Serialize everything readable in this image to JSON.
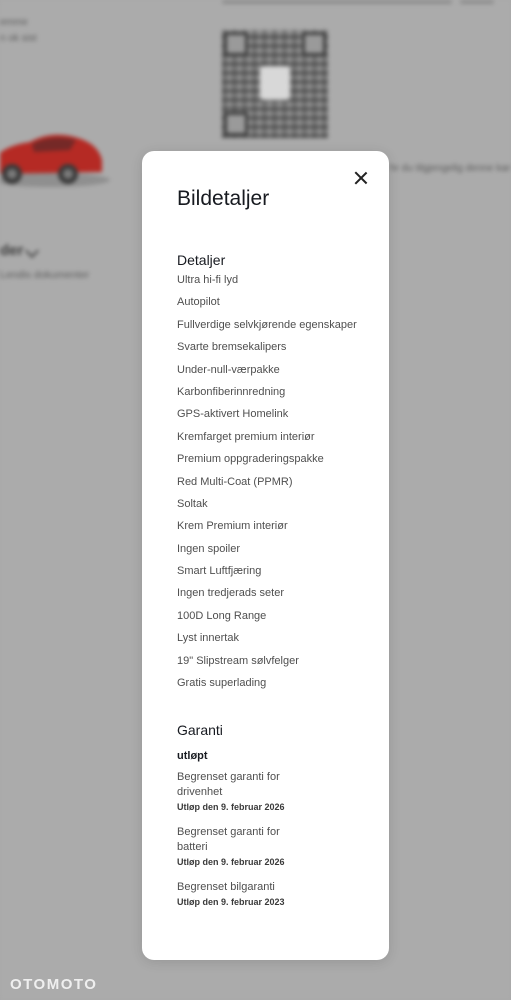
{
  "background": {
    "text_line_1": "emme",
    "text_line_2": "n ok sist",
    "right_note": "hr du tilgjengelig denne kan",
    "heading_fragment": "der",
    "subtext": "Lendis dokumenter",
    "brand": "OTOMOTO"
  },
  "modal": {
    "title": "Bildetaljer",
    "details": {
      "title": "Detaljer",
      "items": [
        "Ultra hi-fi lyd",
        "Autopilot",
        "Fullverdige selvkjørende egenskaper",
        "Svarte bremsekalipers",
        "Under-null-værpakke",
        "Karbonfiberinnredning",
        "GPS-aktivert Homelink",
        "Kremfarget premium interiør",
        "Premium oppgraderingspakke",
        "Red Multi-Coat (PPMR)",
        "Soltak",
        "Krem Premium interiør",
        "Ingen spoiler",
        "Smart Luftfjæring",
        "Ingen tredjerads seter",
        "100D Long Range",
        "Lyst innertak",
        "19\" Slipstream sølvfelger",
        "Gratis superlading"
      ]
    },
    "warranty": {
      "title": "Garanti",
      "status": "utløpt",
      "items": [
        {
          "name": "Begrenset garanti for drivenhet",
          "expiry": "Utløp den 9. februar 2026"
        },
        {
          "name": "Begrenset garanti for batteri",
          "expiry": "Utløp den 9. februar 2026"
        },
        {
          "name": "Begrenset bilgaranti",
          "expiry": "Utløp den 9. februar 2023"
        }
      ]
    }
  }
}
